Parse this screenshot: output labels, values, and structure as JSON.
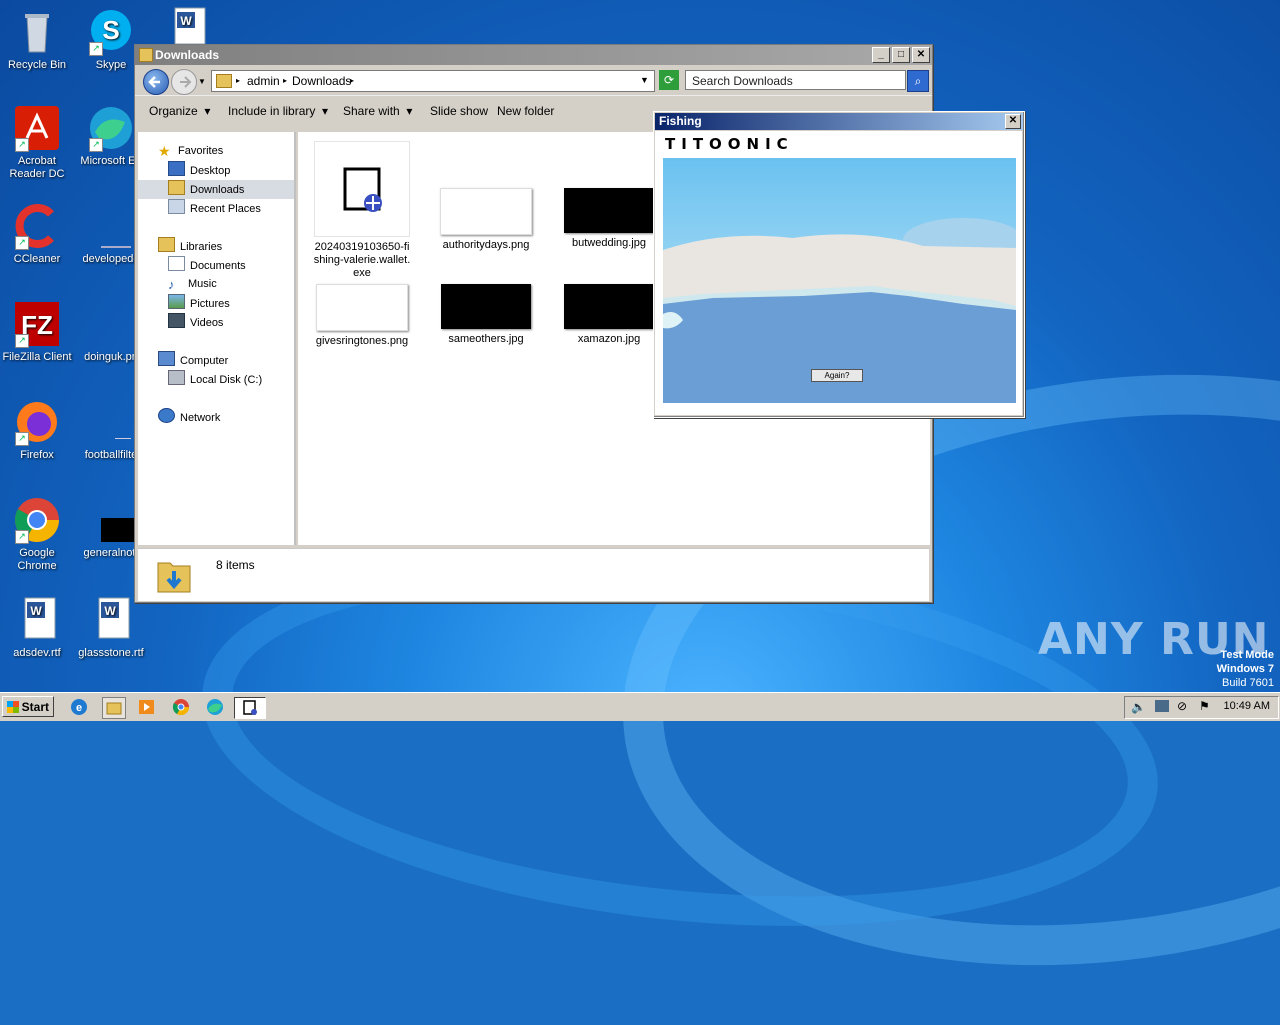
{
  "desktop": {
    "icons": [
      {
        "label": "Recycle Bin"
      },
      {
        "label": "Skype"
      },
      {
        "label": "Acrobat Reader DC"
      },
      {
        "label": "Microsoft Ed"
      },
      {
        "label": "CCleaner"
      },
      {
        "label": "developedd"
      },
      {
        "label": "FileZilla Client"
      },
      {
        "label": "doinguk.pn"
      },
      {
        "label": "Firefox"
      },
      {
        "label": "footballfilte"
      },
      {
        "label": "Google Chrome"
      },
      {
        "label": "generalnot."
      },
      {
        "label": "adsdev.rtf"
      },
      {
        "label": "glassstone.rtf"
      }
    ],
    "watermark": "ANY RUN",
    "test_mode": {
      "line1": "Test Mode",
      "line2": "Windows 7",
      "line3": "Build 7601"
    }
  },
  "explorer": {
    "title": "Downloads",
    "breadcrumb": [
      "admin",
      "Downloads"
    ],
    "search_placeholder": "Search Downloads",
    "toolbar": [
      "Organize",
      "Include in library",
      "Share with",
      "Slide show",
      "New folder"
    ],
    "nav": {
      "favorites": "Favorites",
      "fav_items": [
        "Desktop",
        "Downloads",
        "Recent Places"
      ],
      "libraries": "Libraries",
      "lib_items": [
        "Documents",
        "Music",
        "Pictures",
        "Videos"
      ],
      "computer": "Computer",
      "computer_items": [
        "Local Disk (C:)"
      ],
      "network": "Network"
    },
    "files": [
      {
        "name": "20240319103650-fishing-valerie.wallet.exe"
      },
      {
        "name": "authoritydays.png"
      },
      {
        "name": "butwedding.jpg"
      },
      {
        "name": "givesringtones.png"
      },
      {
        "name": "sameothers.jpg"
      },
      {
        "name": "xamazon.jpg"
      }
    ],
    "status": "8 items"
  },
  "fishing": {
    "title": "Fishing",
    "brand": "TITOONIC",
    "button": "Again?"
  },
  "taskbar": {
    "start": "Start",
    "clock": "10:49 AM"
  }
}
